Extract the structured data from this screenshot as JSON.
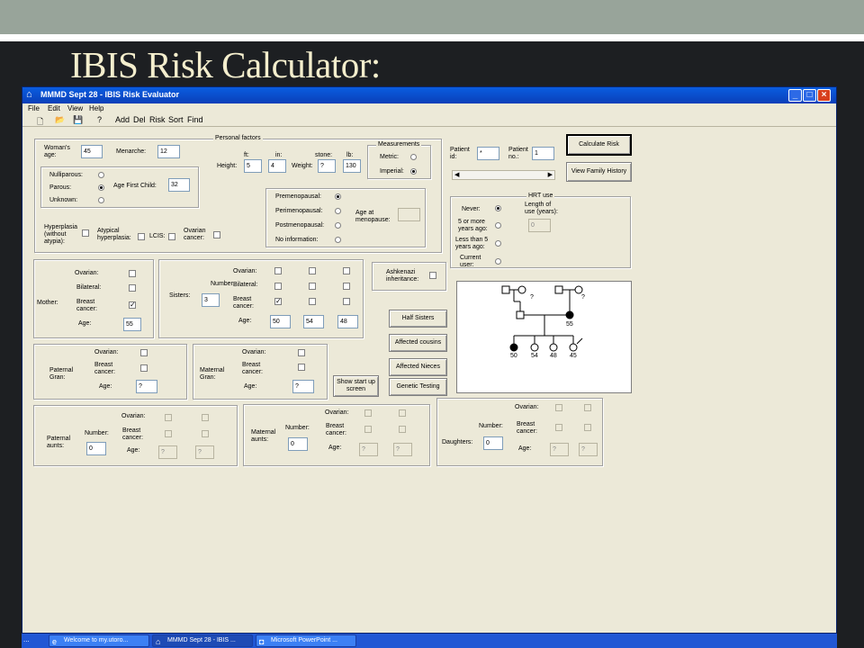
{
  "slide_title": "IBIS Risk Calculator:",
  "window": {
    "title": "MMMD Sept 28 - IBIS Risk Evaluator"
  },
  "menu": [
    "File",
    "Edit",
    "View",
    "Help"
  ],
  "toolbar": {
    "add": "Add",
    "del": "Del",
    "risk": "Risk",
    "sort": "Sort",
    "find": "Find"
  },
  "personal": {
    "group_label": "Personal factors",
    "womans_age_label": "Woman's\nage:",
    "womans_age": "45",
    "menarche_label": "Menarche:",
    "menarche": "12",
    "height_label": "Height:",
    "ft_label": "ft:",
    "in_label": "in:",
    "height_ft": "5",
    "height_in": "4",
    "weight_label": "Weight:",
    "stone_label": "stone:",
    "lb_label": "lb:",
    "weight_stone": "?",
    "weight_lb": "130",
    "measurements_label": "Measurements",
    "metric_label": "Metric:",
    "imperial_label": "Imperial:",
    "nulliparous_label": "Nulliparous:",
    "parous_label": "Parous:",
    "unknown_label": "Unknown:",
    "age_first_child_label": "Age First Child:",
    "age_first_child": "32",
    "premeno_label": "Premenopausal:",
    "perimeno_label": "Perimenopausal:",
    "postmeno_label": "Postmenopausal:",
    "noinfo_label": "No information:",
    "age_meno_label": "Age at\nmenopause:",
    "hyperplasia_label": "Hyperplasia\n(without\natypia):",
    "atypical_label": "Atypical\nhyperplasia:",
    "lcis_label": "LCIS:",
    "ovarian_cancer_label": "Ovarian\ncancer:"
  },
  "patient": {
    "id_label": "Patient\nid:",
    "id": "*",
    "no_label": "Patient\nno.:",
    "no": "1"
  },
  "buttons": {
    "calculate": "Calculate Risk",
    "family_history": "View Family History",
    "half_sisters": "Half Sisters",
    "affected_cousins": "Affected cousins",
    "affected_nieces": "Affected Nieces",
    "genetic_testing": "Genetic Testing",
    "show_start": "Show start\nup screen"
  },
  "hrt": {
    "group_label": "HRT use",
    "never_label": "Never:",
    "five_more_label": "5 or more\nyears ago:",
    "less_five_label": "Less than 5\nyears ago:",
    "current_label": "Current\nuser:",
    "length_label": "Length of\nuse (years):",
    "length": "0"
  },
  "mother": {
    "label": "Mother:",
    "ovarian_label": "Ovarian:",
    "bilateral_label": "Bilateral:",
    "breast_label": "Breast\ncancer:",
    "age_label": "Age:",
    "age": "55"
  },
  "sisters": {
    "label": "Sisters:",
    "number_label": "Number:",
    "number": "3",
    "ovarian_label": "Ovarian:",
    "bilateral_label": "Bilateral:",
    "breast_label": "Breast\ncancer:",
    "age_label": "Age:",
    "ages": [
      "50",
      "54",
      "48"
    ]
  },
  "ashkenazi_label": "Ashkenazi\ninheritance:",
  "paternal_gran": {
    "label": "Paternal\nGran:",
    "ovarian_label": "Ovarian:",
    "breast_label": "Breast\ncancer:",
    "age_label": "Age:",
    "age": "?"
  },
  "maternal_gran": {
    "label": "Maternal\nGran:",
    "ovarian_label": "Ovarian:",
    "breast_label": "Breast\ncancer:",
    "age_label": "Age:",
    "age": "?"
  },
  "paternal_aunts": {
    "label": "Paternal\naunts:",
    "number_label": "Number:",
    "number": "0",
    "ovarian_label": "Ovarian:",
    "breast_label": "Breast\ncancer:",
    "age_label": "Age:",
    "ages": [
      "?",
      "?"
    ]
  },
  "maternal_aunts": {
    "label": "Maternal\naunts:",
    "number_label": "Number:",
    "number": "0",
    "ovarian_label": "Ovarian:",
    "breast_label": "Breast\ncancer:",
    "age_label": "Age:",
    "ages": [
      "?",
      "?"
    ]
  },
  "daughters": {
    "label": "Daughters:",
    "number_label": "Number:",
    "number": "0",
    "ovarian_label": "Ovarian:",
    "breast_label": "Breast\ncancer:",
    "age_label": "Age:",
    "ages": [
      "?",
      "?"
    ]
  },
  "pedigree": {
    "unknown_marks": [
      "?",
      "?"
    ],
    "mother_age": "55",
    "children_ages": [
      "50",
      "54",
      "48",
      "45"
    ]
  },
  "taskbar": {
    "left": "...",
    "items": [
      "Welcome to my.utoro...",
      "MMMD Sept 28 - IBIS ...",
      "Microsoft PowerPoint ..."
    ]
  }
}
